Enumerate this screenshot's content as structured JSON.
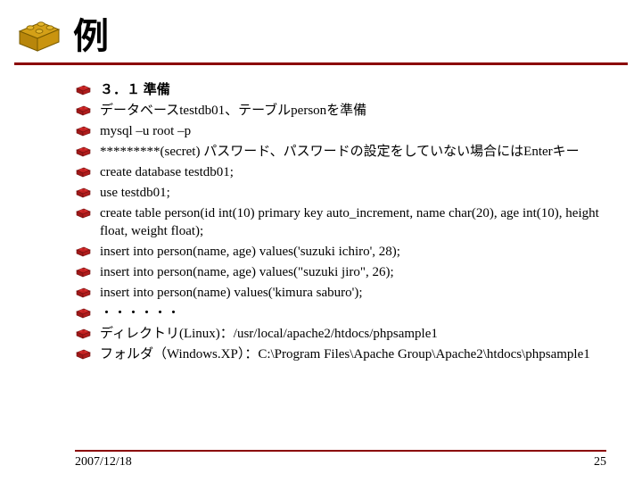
{
  "title": "例",
  "items": [
    {
      "text": "３．１ 準備",
      "bold": true
    },
    {
      "text": "データベースtestdb01、テーブルpersonを準備",
      "bold": false
    },
    {
      "text": "mysql –u root –p",
      "bold": false
    },
    {
      "text": "*********(secret) パスワード、パスワードの設定をしていない場合にはEnterキー",
      "bold": false
    },
    {
      "text": "create database testdb01;",
      "bold": false
    },
    {
      "text": "use testdb01;",
      "bold": false
    },
    {
      "text": "create table person(id int(10) primary key auto_increment, name char(20), age int(10), height float, weight float);",
      "bold": false
    },
    {
      "text": "insert into person(name, age) values('suzuki ichiro', 28);",
      "bold": false
    },
    {
      "text": "insert into person(name, age) values(\"suzuki jiro\", 26);",
      "bold": false
    },
    {
      "text": "insert into person(name) values('kimura saburo');",
      "bold": false
    },
    {
      "text": "・・・・・・",
      "bold": false
    },
    {
      "text": "ディレクトリ(Linux)：/usr/local/apache2/htdocs/phpsample1",
      "bold": false
    },
    {
      "text": "フォルダ（Windows.XP）：C:\\Program Files\\Apache Group\\Apache2\\htdocs\\phpsample1",
      "bold": false
    }
  ],
  "footer": {
    "date": "2007/12/18",
    "page": "25"
  }
}
